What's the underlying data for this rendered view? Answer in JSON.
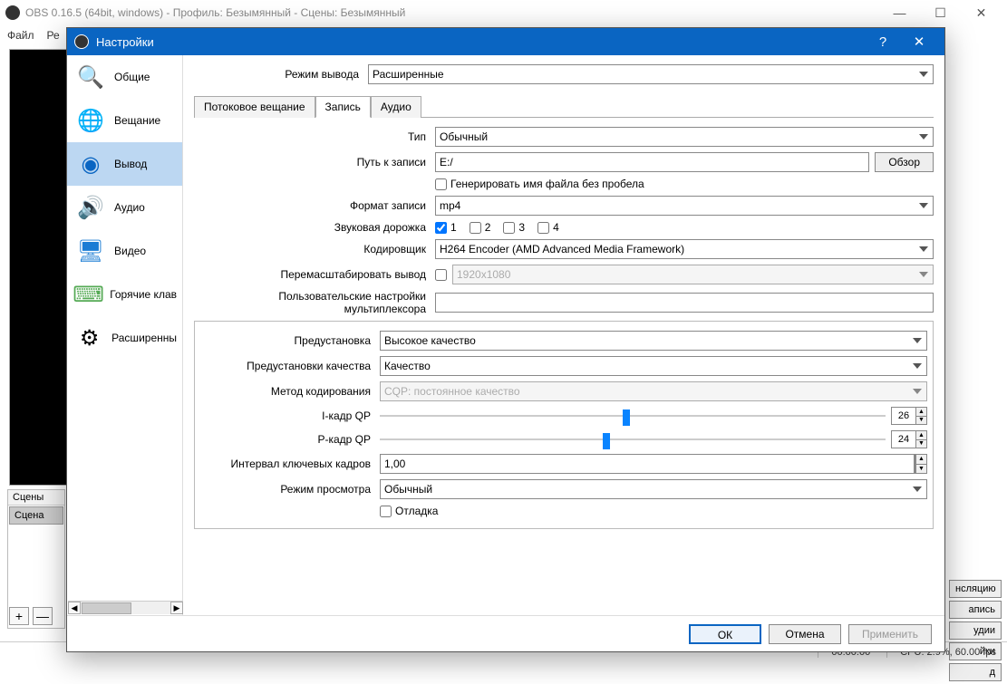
{
  "main_window": {
    "title": "OBS 0.16.5 (64bit, windows) - Профиль: Безымянный - Сцены: Безымянный",
    "menu": {
      "file": "Файл",
      "edit": "Ре"
    }
  },
  "scenes_panel": {
    "header": "Сцены",
    "item": "Сцена"
  },
  "right_buttons": [
    "нсляцию",
    "апись",
    "удии",
    "йки",
    "д"
  ],
  "statusbar": {
    "time": "00:00:00",
    "cpu": "CPU: 2.9%, 60.00 fps"
  },
  "dialog": {
    "title": "Настройки",
    "nav": [
      {
        "label": "Общие",
        "icon": "🔍"
      },
      {
        "label": "Вещание",
        "icon": "🌐"
      },
      {
        "label": "Вывод",
        "icon": "📡",
        "selected": true
      },
      {
        "label": "Аудио",
        "icon": "🔊"
      },
      {
        "label": "Видео",
        "icon": "🖥"
      },
      {
        "label": "Горячие клав",
        "icon": "⌨"
      },
      {
        "label": "Расширенны",
        "icon": "⚙"
      }
    ],
    "output_mode_label": "Режим вывода",
    "output_mode_value": "Расширенные",
    "tabs": {
      "stream": "Потоковое вещание",
      "record": "Запись",
      "audio": "Аудио"
    },
    "fields": {
      "type_label": "Тип",
      "type_value": "Обычный",
      "path_label": "Путь к записи",
      "path_value": "E:/",
      "browse": "Обзор",
      "gen_filename": "Генерировать имя файла без пробела",
      "format_label": "Формат записи",
      "format_value": "mp4",
      "track_label": "Звуковая дорожка",
      "tracks": [
        "1",
        "2",
        "3",
        "4"
      ],
      "encoder_label": "Кодировщик",
      "encoder_value": "H264 Encoder (AMD Advanced Media Framework)",
      "rescale_label": "Перемасштабировать вывод",
      "rescale_value": "1920x1080",
      "mux_label": "Пользовательские настройки мультиплексора",
      "mux_value": ""
    },
    "encoder": {
      "preset_label": "Предустановка",
      "preset_value": "Высокое качество",
      "quality_preset_label": "Предустановки качества",
      "quality_preset_value": "Качество",
      "method_label": "Метод кодирования",
      "method_value": "CQP: постоянное качество",
      "iframe_label": "I-кадр QP",
      "iframe_value": "26",
      "pframe_label": "P-кадр QP",
      "pframe_value": "24",
      "keyint_label": "Интервал ключевых кадров",
      "keyint_value": "1,00",
      "viewmode_label": "Режим просмотра",
      "viewmode_value": "Обычный",
      "debug": "Отладка"
    },
    "buttons": {
      "ok": "ОК",
      "cancel": "Отмена",
      "apply": "Применить"
    }
  }
}
